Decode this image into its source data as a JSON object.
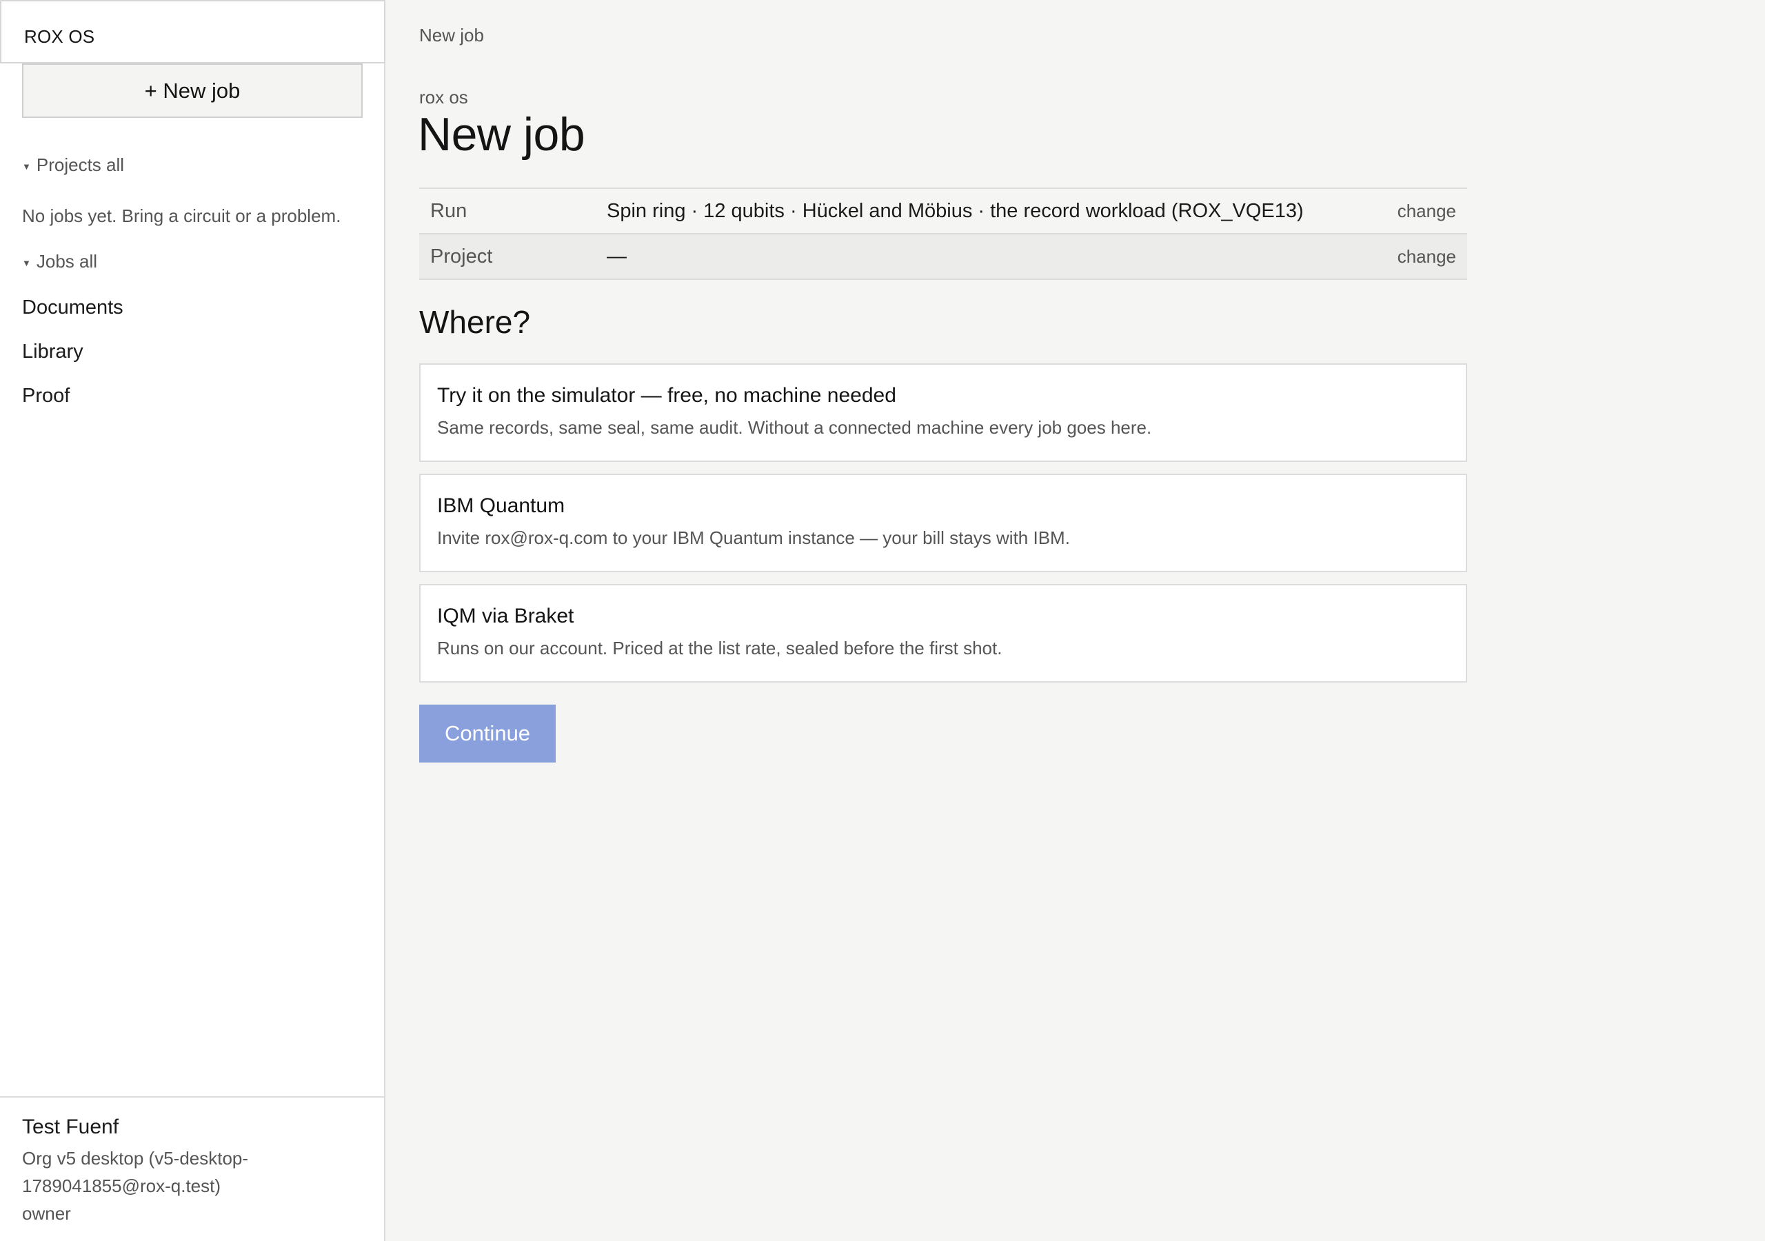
{
  "app": {
    "brand": "ROX OS"
  },
  "sidebar": {
    "new_job_label": "+ New job",
    "projects_heading": "Projects all",
    "projects_empty": "No jobs yet. Bring a circuit or a problem.",
    "jobs_heading": "Jobs all",
    "links": [
      {
        "label": "Documents"
      },
      {
        "label": "Library"
      },
      {
        "label": "Proof"
      }
    ],
    "user": {
      "name": "Test Fuenf",
      "org": "Org v5 desktop (v5-desktop-1789041855@rox-q.test)",
      "role": "owner"
    }
  },
  "main": {
    "breadcrumb": "New job",
    "eyebrow": "rox os",
    "title": "New job",
    "summary": [
      {
        "key": "Run",
        "value": "Spin ring · 12 qubits · Hückel and Möbius · the record workload (ROX_VQE13)",
        "action": "change"
      },
      {
        "key": "Project",
        "value": "—",
        "action": "change"
      }
    ],
    "where_heading": "Where?",
    "options": [
      {
        "title": "Try it on the simulator — free, no machine needed",
        "description": "Same records, same seal, same audit. Without a connected machine every job goes here."
      },
      {
        "title": "IBM Quantum",
        "description": "Invite rox@rox-q.com to your IBM Quantum instance — your bill stays with IBM."
      },
      {
        "title": "IQM via Braket",
        "description": "Runs on our account. Priced at the list rate, sealed before the first shot."
      }
    ],
    "continue_label": "Continue"
  },
  "colors": {
    "accent_disabled": "#8aa0dd",
    "background": "#f5f5f3",
    "sidebar_bg": "#ffffff"
  }
}
